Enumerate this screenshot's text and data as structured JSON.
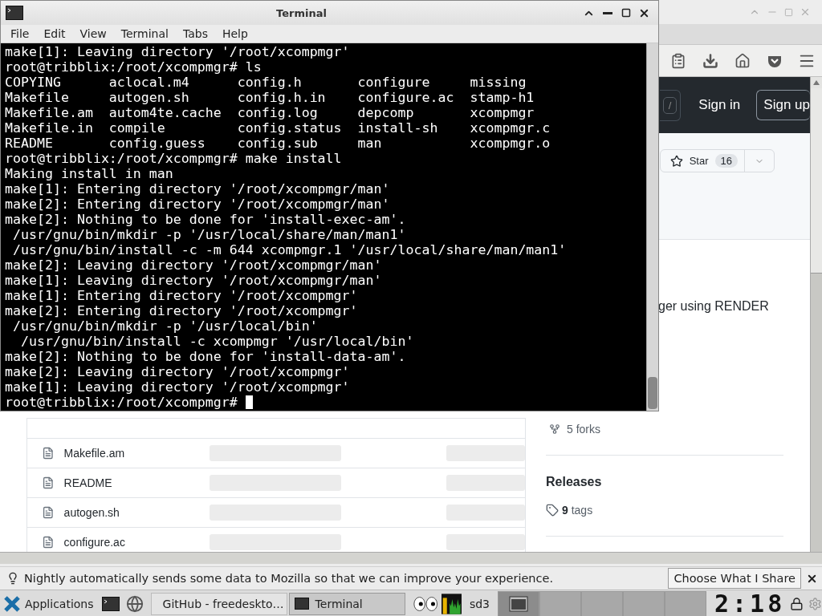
{
  "browser": {
    "header": {
      "search_key": "/",
      "sign_in": "Sign in",
      "sign_up": "Sign up"
    },
    "star_button": {
      "label": "Star",
      "count": "16"
    },
    "about_fragment": "ger using RENDER",
    "forks": "5 forks",
    "releases": {
      "title": "Releases",
      "tags": "**9** tags"
    },
    "files": [
      "Makefile.am",
      "README",
      "autogen.sh",
      "configure.ac"
    ],
    "notification": {
      "text": "Nightly automatically sends some data to Mozilla so that we can improve your experience.",
      "button": "Choose What I Share"
    }
  },
  "terminal": {
    "title": "Terminal",
    "menu": [
      "File",
      "Edit",
      "View",
      "Terminal",
      "Tabs",
      "Help"
    ],
    "lines": [
      "make[1]: Leaving directory '/root/xcompmgr'",
      "root@tribblix:/root/xcompmgr# ls",
      "COPYING      aclocal.m4      config.h       configure     missing",
      "Makefile     autogen.sh      config.h.in    configure.ac  stamp-h1",
      "Makefile.am  autom4te.cache  config.log     depcomp       xcompmgr",
      "Makefile.in  compile         config.status  install-sh    xcompmgr.c",
      "README       config.guess    config.sub     man           xcompmgr.o",
      "root@tribblix:/root/xcompmgr# make install",
      "Making install in man",
      "make[1]: Entering directory '/root/xcompmgr/man'",
      "make[2]: Entering directory '/root/xcompmgr/man'",
      "make[2]: Nothing to be done for 'install-exec-am'.",
      " /usr/gnu/bin/mkdir -p '/usr/local/share/man/man1'",
      " /usr/gnu/bin/install -c -m 644 xcompmgr.1 '/usr/local/share/man/man1'",
      "make[2]: Leaving directory '/root/xcompmgr/man'",
      "make[1]: Leaving directory '/root/xcompmgr/man'",
      "make[1]: Entering directory '/root/xcompmgr'",
      "make[2]: Entering directory '/root/xcompmgr'",
      " /usr/gnu/bin/mkdir -p '/usr/local/bin'",
      "  /usr/gnu/bin/install -c xcompmgr '/usr/local/bin'",
      "make[2]: Nothing to be done for 'install-data-am'.",
      "make[2]: Leaving directory '/root/xcompmgr'",
      "make[1]: Leaving directory '/root/xcompmgr'",
      "root@tribblix:/root/xcompmgr# "
    ]
  },
  "taskbar": {
    "start": "Applications",
    "tasks": [
      {
        "label": "GitHub - freedeskto…",
        "selected": false
      },
      {
        "label": "Terminal",
        "selected": true
      }
    ],
    "monitor_label": "sd3",
    "workspaces": [
      {
        "selected": true
      },
      {
        "selected": false
      },
      {
        "selected": false
      },
      {
        "selected": false
      },
      {
        "selected": false
      }
    ],
    "clock": "2:18"
  }
}
